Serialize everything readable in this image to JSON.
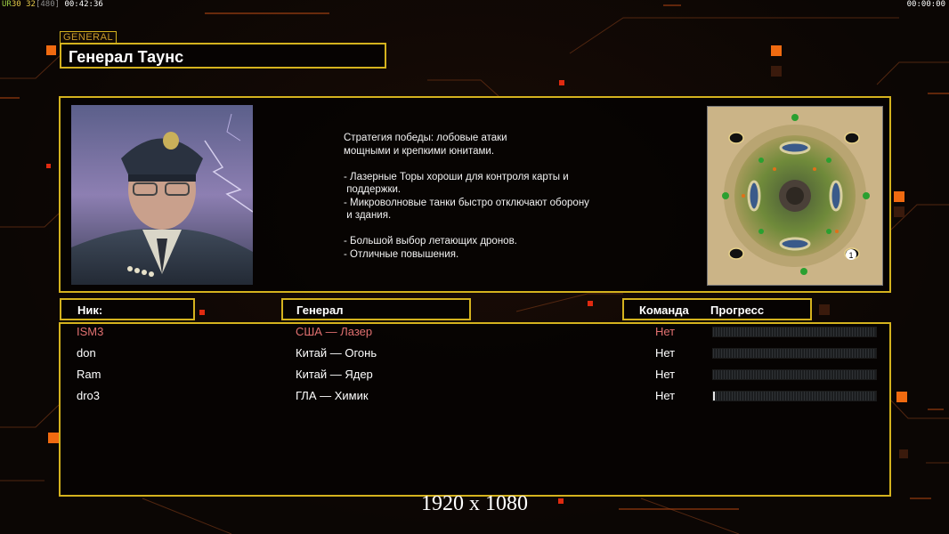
{
  "topbar": {
    "ur": "UR",
    "num1": "30",
    "num2": "32",
    "num3": "[480]",
    "time_left": "00:42:36",
    "time_right": "00:00:00"
  },
  "colors": {
    "accent": "#d4b21e",
    "highlight_row": "#e07070",
    "text": "#ffffff"
  },
  "general": {
    "tag": "GENERAL",
    "name": "Генерал Таунс",
    "description": [
      "Стратегия победы: лобовые атаки",
      "мощными и крепкими юнитами.",
      "",
      "- Лазерные Торы хороши для контроля карты и",
      " поддержки.",
      "- Микроволновые танки быстро отключают оборону",
      " и здания.",
      "",
      "- Большой выбор летающих дронов.",
      "- Отличные повышения."
    ]
  },
  "minimap": {
    "start_marker": "1"
  },
  "headers": {
    "nick": "Ник:",
    "general": "Генерал",
    "team": "Команда",
    "progress": "Прогресс"
  },
  "players": [
    {
      "nick": "ISM3",
      "general": "США — Лазер",
      "team": "Нет",
      "progress": 0.0,
      "highlight": true
    },
    {
      "nick": "don",
      "general": "Китай — Огонь",
      "team": "Нет",
      "progress": 0.0,
      "highlight": false
    },
    {
      "nick": "Ram",
      "general": "Китай — Ядер",
      "team": "Нет",
      "progress": 0.0,
      "highlight": false
    },
    {
      "nick": "dro3",
      "general": "ГЛА — Химик",
      "team": "Нет",
      "progress": 0.01,
      "highlight": false
    }
  ],
  "resolution": "1920 x 1080"
}
